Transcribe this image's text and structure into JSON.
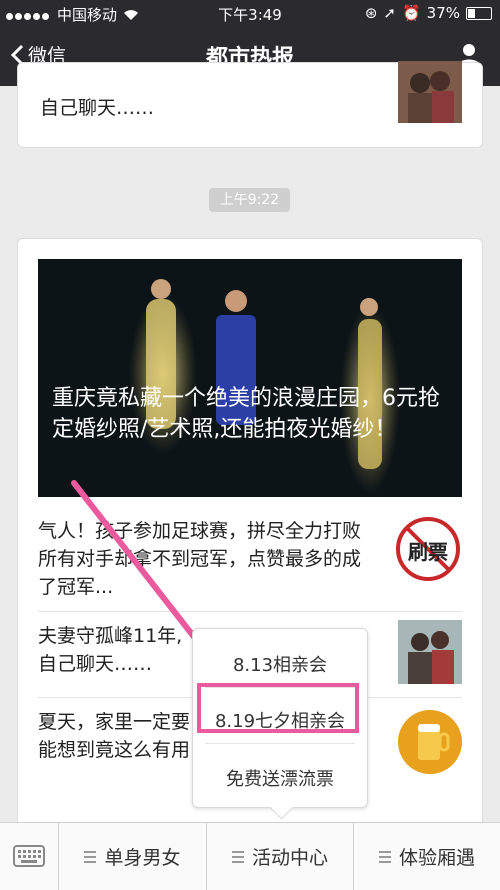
{
  "status": {
    "carrier": "中国移动",
    "time": "下午3:49",
    "battery": "37%",
    "battery_level": 0.37
  },
  "nav": {
    "back_label": "微信",
    "title": "都市热报"
  },
  "prev_card": {
    "text": "自己聊天……"
  },
  "timestamp": "上午9:22",
  "article": {
    "hero_title": "重庆竟私藏一个绝美的浪漫庄园，6元抢定婚纱照/艺术照,还能拍夜光婚纱！",
    "items": [
      {
        "text": "气人！孩子参加足球赛，拼尽全力打败所有对手却拿不到冠军，点赞最多的成了冠军...",
        "thumb_text": "刷票"
      },
      {
        "text": "夫妻守孤峰11年,",
        "text2": "自己聊天……"
      },
      {
        "text": "夏天，家里一定要",
        "text2": "能想到竟这么有用"
      }
    ]
  },
  "popup": {
    "options": [
      "8.13相亲会",
      "8.19七夕相亲会",
      "免费送漂流票"
    ]
  },
  "bottom_menu": {
    "tabs": [
      "单身男女",
      "活动中心",
      "体验厢遇"
    ]
  },
  "colors": {
    "bar_dark": "#2a2a2f",
    "highlight_pink": "#ea5a9c"
  }
}
